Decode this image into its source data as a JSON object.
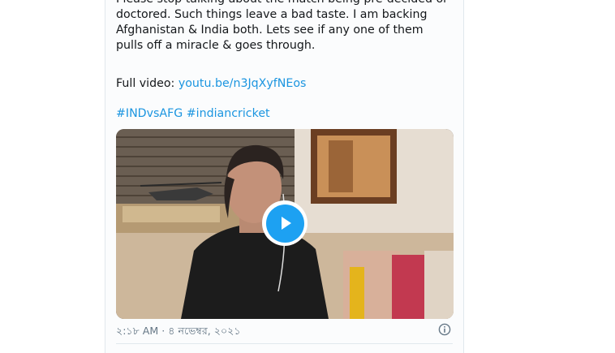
{
  "tweet": {
    "text": "Please stop talking about the match being pre-decided or\ndoctored. Such things leave a bad taste. I am backing\nAfghanistan & India both. Lets see if any one of them\npulls off a miracle & goes through.",
    "full_video_prefix": "Full video: ",
    "full_video_link": "youtu.be/n3JqXyfNEos",
    "hashtags": [
      "#INDvsAFG",
      "#indiancricket"
    ],
    "timestamp": "২:১৮ AM · ৪ নভেম্বর, ২০২১"
  },
  "video": {
    "play_icon": "play-icon"
  },
  "icons": {
    "info": "info-icon"
  },
  "colors": {
    "link": "#1b95e0",
    "play": "#1da1f2",
    "muted": "#657786"
  }
}
